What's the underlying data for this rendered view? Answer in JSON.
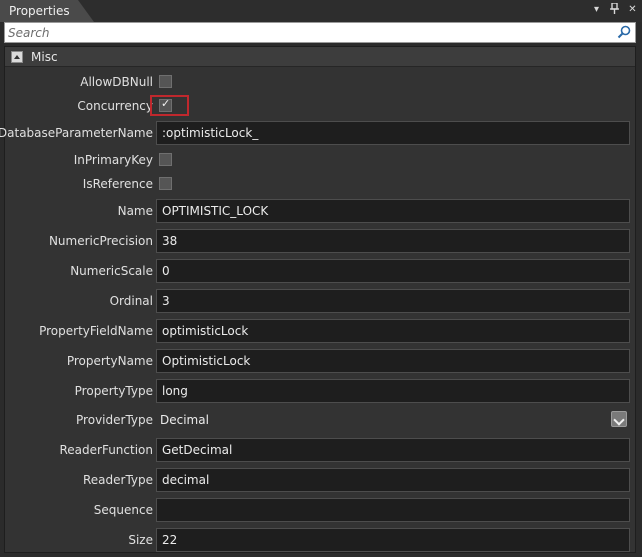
{
  "window": {
    "tab_title": "Properties",
    "icons": [
      "dropdown-icon",
      "pin-icon",
      "close-icon"
    ]
  },
  "search": {
    "placeholder": "Search"
  },
  "category": {
    "label": "Misc"
  },
  "properties": {
    "AllowDBNull": {
      "label": "AllowDBNull",
      "checked": false
    },
    "Concurrency": {
      "label": "Concurrency",
      "checked": true
    },
    "DatabaseParameterName": {
      "label": "DatabaseParameterName",
      "value": ":optimisticLock_"
    },
    "InPrimaryKey": {
      "label": "InPrimaryKey",
      "checked": false
    },
    "IsReference": {
      "label": "IsReference",
      "checked": false
    },
    "Name": {
      "label": "Name",
      "value": "OPTIMISTIC_LOCK"
    },
    "NumericPrecision": {
      "label": "NumericPrecision",
      "value": "38"
    },
    "NumericScale": {
      "label": "NumericScale",
      "value": "0"
    },
    "Ordinal": {
      "label": "Ordinal",
      "value": "3"
    },
    "PropertyFieldName": {
      "label": "PropertyFieldName",
      "value": "optimisticLock"
    },
    "PropertyName": {
      "label": "PropertyName",
      "value": "OptimisticLock"
    },
    "PropertyType": {
      "label": "PropertyType",
      "value": "long"
    },
    "ProviderType": {
      "label": "ProviderType",
      "value": "Decimal"
    },
    "ReaderFunction": {
      "label": "ReaderFunction",
      "value": "GetDecimal"
    },
    "ReaderType": {
      "label": "ReaderType",
      "value": "decimal"
    },
    "Sequence": {
      "label": "Sequence",
      "value": ""
    },
    "Size": {
      "label": "Size",
      "value": "22"
    }
  },
  "colors": {
    "highlight": "#c0282d",
    "background": "#333333",
    "field": "#1e1e1e"
  }
}
